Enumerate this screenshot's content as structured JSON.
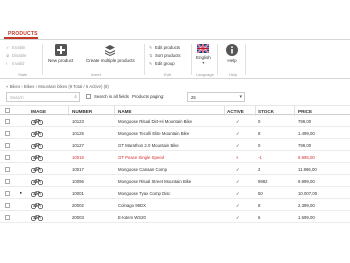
{
  "tabs": {
    "products": "PRODUCTS"
  },
  "ribbon": {
    "groups": {
      "state": "State",
      "insert": "Insert",
      "edit": "Edit",
      "language": "Language",
      "help": "Help"
    },
    "state_buttons": [
      "Enable",
      "Disable",
      "Invalid"
    ],
    "insert_buttons": {
      "new_product": "New product",
      "create_multiple": "Create multiple products"
    },
    "edit_buttons": [
      "Edit products",
      "Sort products",
      "Edit group"
    ],
    "language_button": "English",
    "help_button": "Help"
  },
  "breadcrumb": "« Bikes › Bikes › Mountain bikes (9 Total / 6 Active) (8)",
  "toolbar": {
    "search_placeholder": "Search",
    "search_all_fields_label": "Search in all fields",
    "products_paging_label": "Products paging:",
    "products_paging_value": "25"
  },
  "table": {
    "headers": [
      "IMAGE",
      "NUMBER",
      "NAME",
      "ACTIVE",
      "STOCK",
      "PRICE"
    ],
    "rows": [
      {
        "number": "10123",
        "name": "Mongoose Ritual Dirt-Hi Mountain Bike",
        "active": "✓",
        "stock": "0",
        "price": "799,00",
        "has_image": true,
        "highlight": false,
        "expand": false
      },
      {
        "number": "10125",
        "name": "Mongoose Tecolli Elite Mountain Bike",
        "active": "✓",
        "stock": "8",
        "price": "1.499,00",
        "has_image": true,
        "highlight": false,
        "expand": false
      },
      {
        "number": "10127",
        "name": "GT Marathon 2.0 Mountain Bike",
        "active": "✓",
        "stock": "0",
        "price": "799,00",
        "has_image": true,
        "highlight": false,
        "expand": false
      },
      {
        "number": "10016",
        "name": "GT Peace Single Speed",
        "active": "×",
        "stock": "-1",
        "price": "6.995,00",
        "has_image": true,
        "highlight": true,
        "expand": false
      },
      {
        "number": "10017",
        "name": "Mongoose Canaan Comp",
        "active": "✓",
        "stock": "2",
        "price": "11.996,00",
        "has_image": true,
        "highlight": false,
        "expand": false
      },
      {
        "number": "10096",
        "name": "Mongoose Ritual Street Mountain Bike",
        "active": "✓",
        "stock": "9982",
        "price": "9.999,00",
        "has_image": true,
        "highlight": false,
        "expand": false
      },
      {
        "number": "10001",
        "name": "Mongoose Tyax Comp Disc",
        "active": "✓",
        "stock": "50",
        "price": "10.007,00",
        "has_image": true,
        "highlight": false,
        "expand": true
      },
      {
        "number": "20002",
        "name": "Colnago 99DX",
        "active": "✓",
        "stock": "8",
        "price": "2.399,00",
        "has_image": true,
        "highlight": false,
        "expand": false
      },
      {
        "number": "20003",
        "name": "E-totem WS20",
        "active": "✓",
        "stock": "6",
        "price": "1.699,00",
        "has_image": true,
        "highlight": false,
        "expand": false
      }
    ]
  },
  "colors": {
    "accent": "#c0392b",
    "warning": "#d32f2f"
  }
}
